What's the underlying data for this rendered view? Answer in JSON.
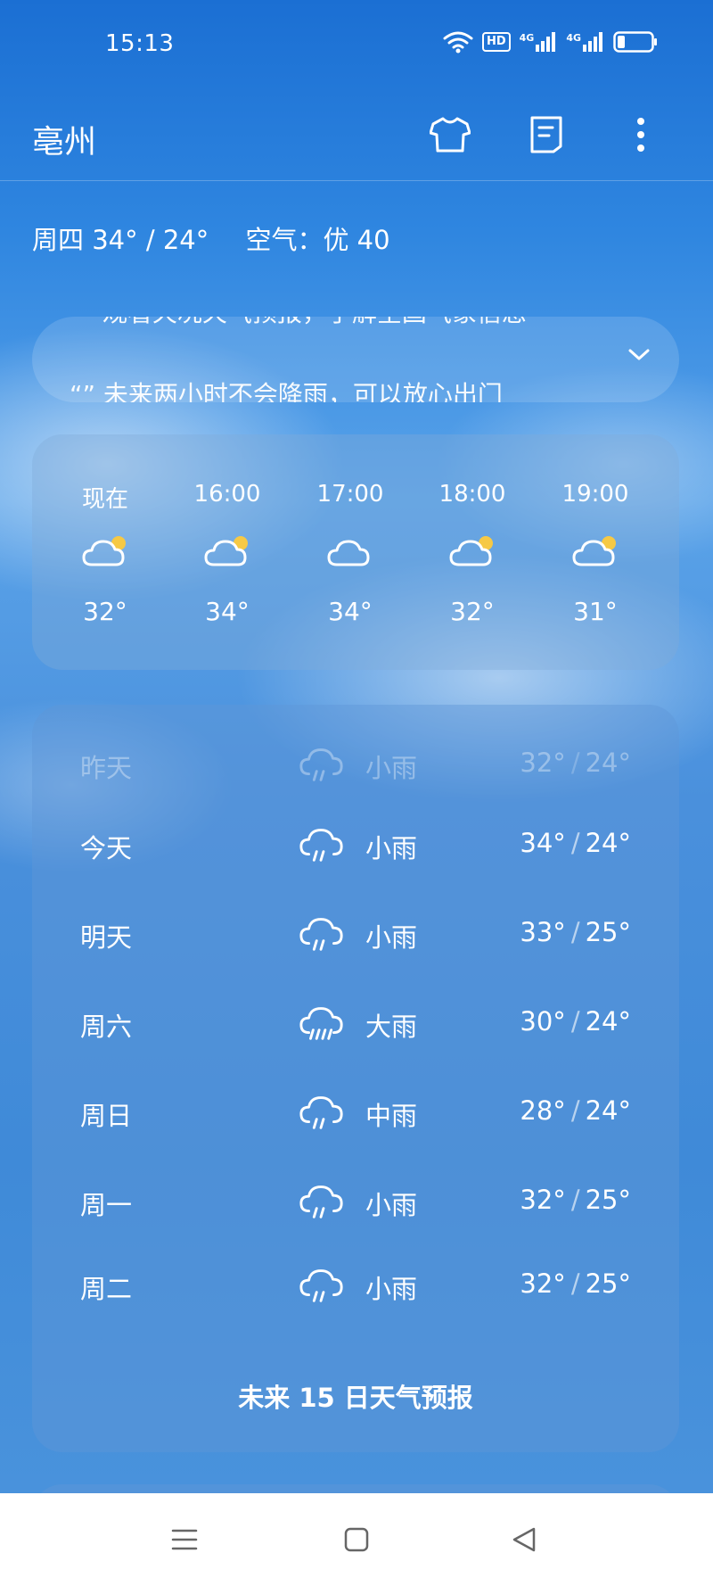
{
  "status_bar": {
    "time": "15:13",
    "hd_label": "HD",
    "net1": "4G",
    "net2": "4G"
  },
  "header": {
    "city": "亳州"
  },
  "summary": {
    "day_temp": "周四 34° / 24°",
    "air_quality": "空气：优 40"
  },
  "alert": {
    "line1": "一 观看天况天气预报，了解全国气象信息",
    "line2": "“” 未来两小时不会降雨，可以放心出门"
  },
  "hourly": [
    {
      "time": "现在",
      "icon": "partly-cloudy-icon",
      "temp": "32°"
    },
    {
      "time": "16:00",
      "icon": "partly-cloudy-icon",
      "temp": "34°"
    },
    {
      "time": "17:00",
      "icon": "cloudy-icon",
      "temp": "34°"
    },
    {
      "time": "18:00",
      "icon": "partly-cloudy-icon",
      "temp": "32°"
    },
    {
      "time": "19:00",
      "icon": "partly-cloudy-icon",
      "temp": "31°"
    }
  ],
  "daily": [
    {
      "day": "昨天",
      "icon": "rain-icon",
      "condition": "小雨",
      "high": "32°",
      "low": "24°"
    },
    {
      "day": "今天",
      "icon": "rain-icon",
      "condition": "小雨",
      "high": "34°",
      "low": "24°"
    },
    {
      "day": "明天",
      "icon": "rain-icon",
      "condition": "小雨",
      "high": "33°",
      "low": "25°"
    },
    {
      "day": "周六",
      "icon": "heavy-rain-icon",
      "condition": "大雨",
      "high": "30°",
      "low": "24°"
    },
    {
      "day": "周日",
      "icon": "rain-icon",
      "condition": "中雨",
      "high": "28°",
      "low": "24°"
    },
    {
      "day": "周一",
      "icon": "rain-icon",
      "condition": "小雨",
      "high": "32°",
      "low": "25°"
    },
    {
      "day": "周二",
      "icon": "rain-icon",
      "condition": "小雨",
      "high": "32°",
      "low": "25°"
    }
  ],
  "forecast_link": "未来 15 日天气预报",
  "colors": {
    "sun": "#f6c945",
    "nav_bg": "#ffffff",
    "nav_icon": "#666666"
  }
}
